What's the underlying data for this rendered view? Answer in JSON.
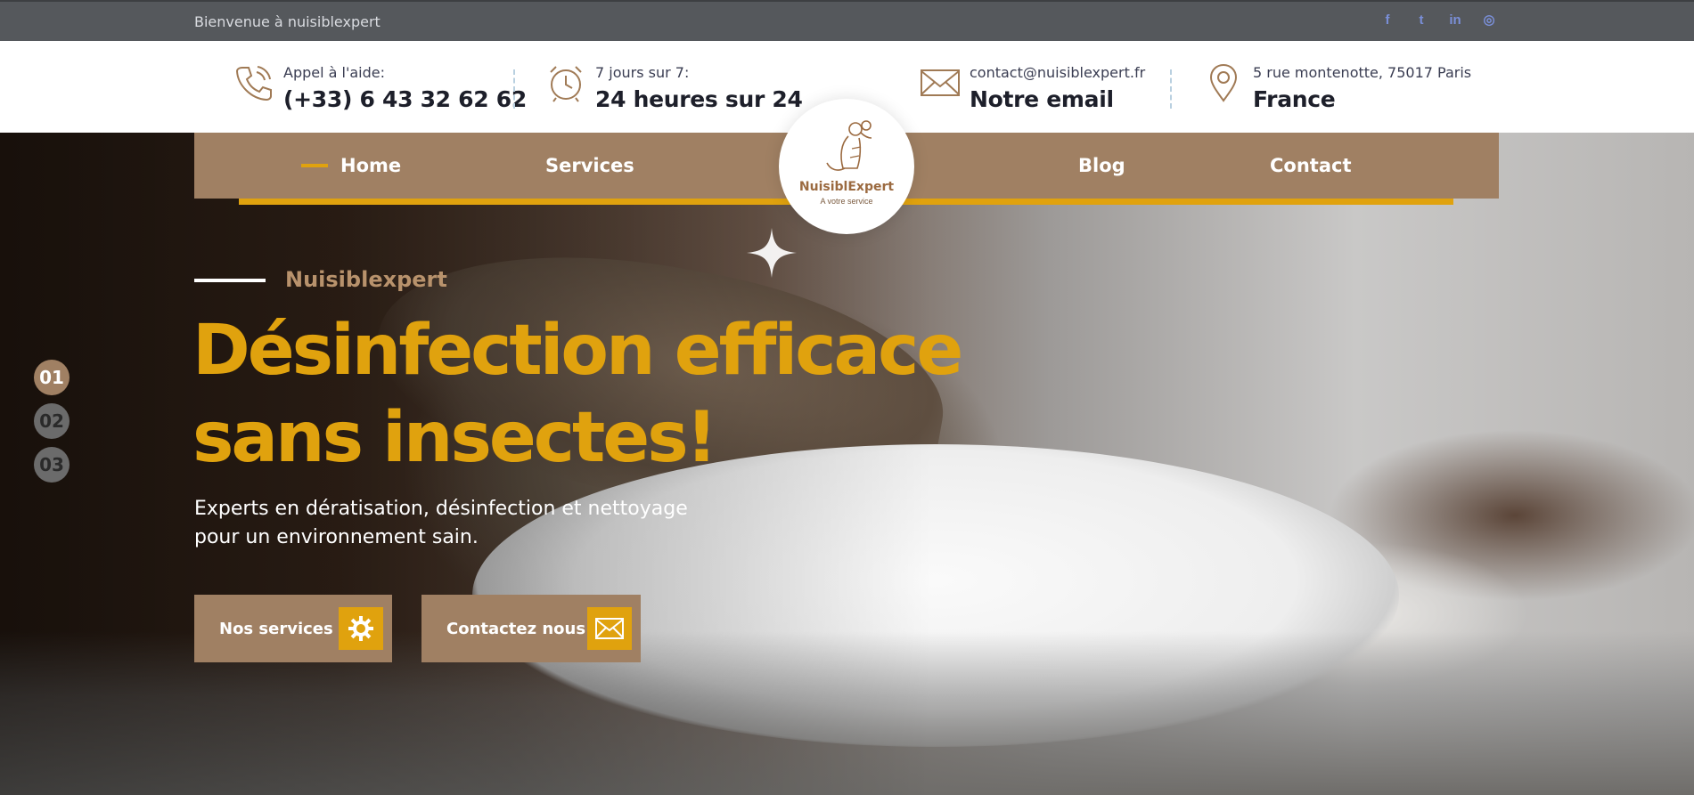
{
  "topbar": {
    "welcome": "Bienvenue à nuisiblexpert",
    "socials": [
      {
        "icon": "facebook-icon",
        "glyph": "f"
      },
      {
        "icon": "twitter-icon",
        "glyph": "t"
      },
      {
        "icon": "linkedin-icon",
        "glyph": "in"
      },
      {
        "icon": "instagram-icon",
        "glyph": "◎"
      }
    ]
  },
  "info": {
    "phone": {
      "label": "Appel à l'aide:",
      "value": "(+33) 6 43 32 62 62"
    },
    "hours": {
      "label": "7 jours sur 7:",
      "value": "24 heures sur 24"
    },
    "email": {
      "label": "contact@nuisiblexpert.fr",
      "value": "Notre email"
    },
    "address": {
      "label": "5 rue montenotte, 75017 Paris",
      "value": "France"
    }
  },
  "nav": {
    "items": [
      "Home",
      "Services",
      "Blog",
      "Contact"
    ],
    "active": "Home"
  },
  "logo": {
    "brand": "NuisiblExpert",
    "tagline": "A votre service"
  },
  "hero": {
    "eyebrow": "Nuisiblexpert",
    "headline_line1": "Désinfection efficace",
    "headline_line2": "sans insectes!",
    "subtext_line1": "Experts en dératisation, désinfection et nettoyage",
    "subtext_line2": "pour un environnement sain.",
    "buttons": [
      {
        "label": "Nos services",
        "icon": "gear-icon"
      },
      {
        "label": "Contactez nous",
        "icon": "envelope-icon"
      }
    ]
  },
  "slider": {
    "dots": [
      "01",
      "02",
      "03"
    ],
    "active": "01"
  },
  "colors": {
    "brown": "#a08063",
    "gold": "#e0a20e",
    "topbar": "#55585c"
  }
}
